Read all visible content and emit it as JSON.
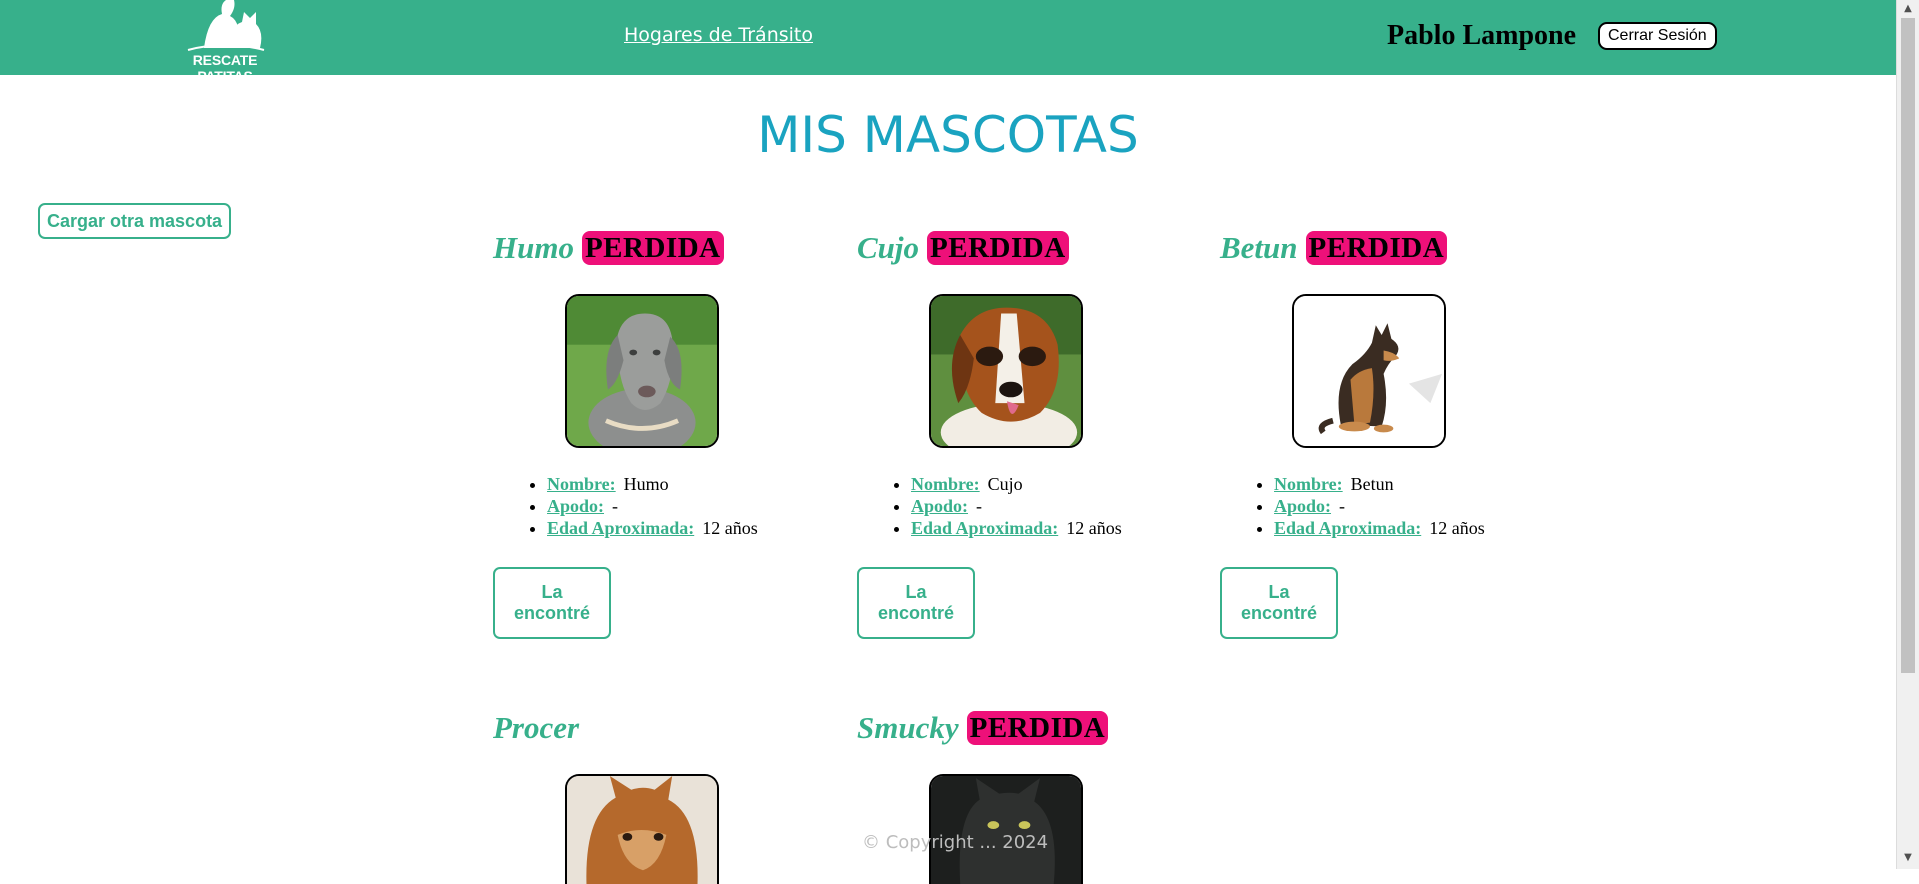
{
  "header": {
    "logo_text": "RESCATE PATITAS",
    "nav_link": "Hogares de Tránsito",
    "user_name": "Pablo Lampone",
    "logout_label": "Cerrar Sesión"
  },
  "page": {
    "title": "MIS MASCOTAS",
    "add_pet_label": "Cargar otra mascota"
  },
  "labels": {
    "nombre": "Nombre:",
    "apodo": "Apodo:",
    "edad": "Edad Aproximada:",
    "found_button": "La encontré",
    "lost_badge": "PERDIDA"
  },
  "pets": [
    {
      "name": "Humo",
      "lost": true,
      "nombre": "Humo",
      "apodo": "-",
      "edad": "12 años",
      "photo": "weimaraner-dog"
    },
    {
      "name": "Cujo",
      "lost": true,
      "nombre": "Cujo",
      "apodo": "-",
      "edad": "12 años",
      "photo": "saint-bernard-dog"
    },
    {
      "name": "Betun",
      "lost": true,
      "nombre": "Betun",
      "apodo": "-",
      "edad": "12 años",
      "photo": "shepherd-dog"
    },
    {
      "name": "Procer",
      "lost": false,
      "photo": "collie-dog"
    },
    {
      "name": "Smucky",
      "lost": true,
      "photo": "dark-cat"
    }
  ],
  "footer": {
    "text": "© Copyright ... 2024"
  },
  "colors": {
    "brand_green": "#37b08b",
    "title_blue": "#1aa3c0",
    "lost_pink": "#ee1079"
  }
}
